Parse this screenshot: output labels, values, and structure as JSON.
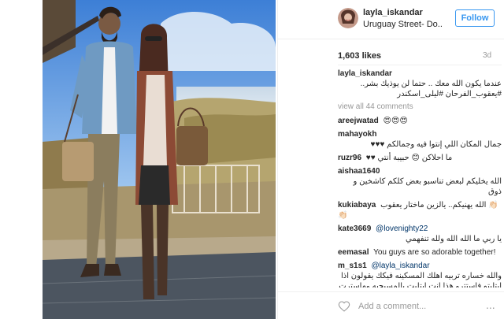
{
  "post": {
    "username": "layla_iskandar",
    "location": "Uruguay Street- Do...",
    "follow_label": "Follow",
    "likes": "1,603 likes",
    "age": "3d"
  },
  "caption": {
    "user": "layla_iskandar",
    "text": "عندما يكون الله معك .. حتما لن يوذيك بشر.. #يعقوب_الفرحان #ليلى_اسكندر"
  },
  "view_all": "view all 44 comments",
  "comments": [
    {
      "user": "areejwatad",
      "text": "😍😍😍"
    },
    {
      "user": "mahayokh",
      "text": "جمال المكان اللي إنتوا فيه وجمالكم ♥♥♥"
    },
    {
      "user": "ruzr96",
      "text": "♥♥ ما احلاكن 😊 حبيبة أنتي"
    },
    {
      "user": "aishaa1640",
      "text": "الله يخليكم لبعض تناسبو بعض كلكم كاشخين و ذوق"
    },
    {
      "user": "kukiabaya",
      "text": "الله يهنيكم.. يالزين ماختار يعقوب 👏🏻👏🏻"
    },
    {
      "user": "kate3669",
      "mention": "@lovenighty22",
      "text": "يا ربي ما الله الله ولله تنفهمي"
    },
    {
      "user": "eemasal",
      "text": "You guys are so adorable together!"
    },
    {
      "user": "m_s1s1",
      "mention": "@layla_iskandar",
      "text": "والله خساره تربيه اهلك المسكينه فيكك يقولون اذا ابتليتو فاستترو هذا انت ابتليت بالمسيحيه وماسترت نفسك ولا سترررتك انت مالك عذ ودي يقراء عليك شيخ والله التفيق الي انت فيه راح ترجع لا احلاكي ازا انت"
    }
  ],
  "footer": {
    "add_comment": "Add a comment...",
    "more": "..."
  },
  "colors": {
    "accent": "#3897f0",
    "muted": "#999999",
    "border": "#efefef"
  }
}
